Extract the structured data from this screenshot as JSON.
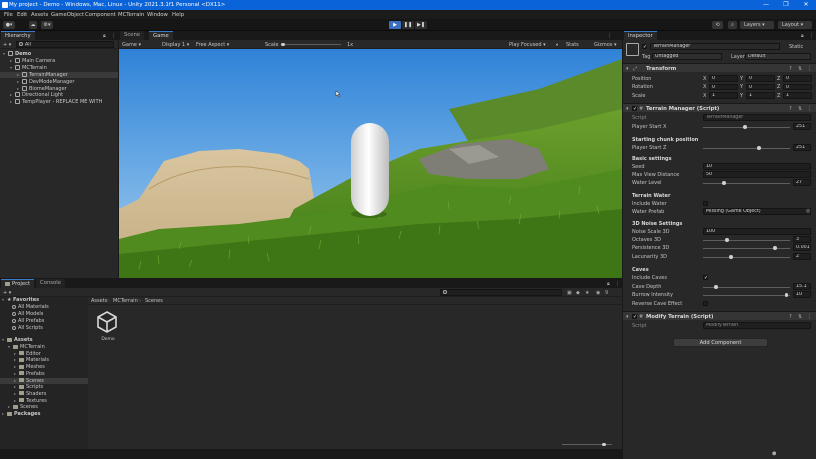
{
  "window": {
    "title": "My project - Demo - Windows, Mac, Linux - Unity 2021.3.1f1 Personal <DX11>",
    "min": "—",
    "max": "❐",
    "close": "✕"
  },
  "menu": [
    "File",
    "Edit",
    "Assets",
    "GameObject",
    "Component",
    "MCTerrain",
    "Window",
    "Help"
  ],
  "toolbar": {
    "play": "▶",
    "pause": "❚❚",
    "step": "▶❚",
    "layers": "Layers",
    "layout": "Layout"
  },
  "hierarchy": {
    "tab": "Hierarchy",
    "add": "+ ▾",
    "search_placeholder": "All",
    "items": [
      {
        "label": "Demo",
        "indent": 0
      },
      {
        "label": "Main Camera",
        "indent": 1
      },
      {
        "label": "MCTerrain",
        "indent": 1
      },
      {
        "label": "TerrainManager",
        "indent": 2,
        "selected": true
      },
      {
        "label": "DevModeManager",
        "indent": 2
      },
      {
        "label": "BiomeManager",
        "indent": 2
      },
      {
        "label": "Directional Light",
        "indent": 1
      },
      {
        "label": "TempPlayer - REPLACE ME WITH",
        "indent": 1
      }
    ]
  },
  "scene_tabs": [
    {
      "label": "Scene"
    },
    {
      "label": "Game"
    }
  ],
  "game_bar": {
    "display": "Game",
    "display_num": "Display 1",
    "aspect": "Free Aspect",
    "scale_label": "Scale",
    "scale_value": "1x",
    "play_mode": "Play Focused",
    "stats": "Stats",
    "gizmos": "Gizmos"
  },
  "bottom_tabs": [
    {
      "label": "Project"
    },
    {
      "label": "Console"
    }
  ],
  "project": {
    "badge": "9",
    "favorites": {
      "label": "Favorites",
      "items": [
        "All Materials",
        "All Models",
        "All Prefabs",
        "All Scripts"
      ]
    },
    "assets": {
      "label": "Assets",
      "tree": [
        {
          "label": "MCTerrain",
          "indent": 1
        },
        {
          "label": "Editor",
          "indent": 2
        },
        {
          "label": "Materials",
          "indent": 2
        },
        {
          "label": "Meshes",
          "indent": 2
        },
        {
          "label": "Prefabs",
          "indent": 2
        },
        {
          "label": "Scenes",
          "indent": 2,
          "selected": true
        },
        {
          "label": "Scripts",
          "indent": 2
        },
        {
          "label": "Shaders",
          "indent": 2
        },
        {
          "label": "Textures",
          "indent": 2
        },
        {
          "label": "Scenes",
          "indent": 1
        }
      ]
    },
    "packages": "Packages",
    "breadcrumb": [
      "Assets",
      "MCTerrain",
      "Scenes"
    ],
    "files": [
      {
        "name": "Demo"
      }
    ]
  },
  "inspector": {
    "tab": "Inspector",
    "object_name": "TerrainManager",
    "static": "Static",
    "tag_label": "Tag",
    "tag": "Untagged",
    "layer_label": "Layer",
    "layer": "Default",
    "transform": {
      "title": "Transform",
      "rows": [
        {
          "label": "Position",
          "x": "0",
          "y": "0",
          "z": "0"
        },
        {
          "label": "Rotation",
          "x": "0",
          "y": "0",
          "z": "0"
        },
        {
          "label": "Scale",
          "x": "1",
          "y": "1",
          "z": "1"
        }
      ]
    },
    "terrain_manager": {
      "title": "Terrain Manager (Script)",
      "script_label": "Script",
      "script": "TerrainManager",
      "player_start_x": {
        "label": "Player Start X",
        "value": "251",
        "fraction": 0.48
      },
      "starting_chunk": "Starting chunk position",
      "player_start_z": {
        "label": "Player Start Z",
        "value": "251",
        "fraction": 0.64
      },
      "basic_settings": "Basic settings",
      "seed": {
        "label": "Seed",
        "value": "10"
      },
      "max_view": {
        "label": "Max View Distance",
        "value": "50"
      },
      "water_level": {
        "label": "Water Level",
        "value": "27",
        "fraction": 0.24
      },
      "terrain_water": "Terrain Water",
      "include_water": {
        "label": "Include Water"
      },
      "water_prefab": {
        "label": "Water Prefab",
        "value": "Missing (Game Object)"
      },
      "noise3d": "3D Noise Settings",
      "noise_scale": {
        "label": "Noise Scale 3D",
        "value": "100"
      },
      "octaves": {
        "label": "Octaves 3D",
        "value": "3",
        "fraction": 0.28
      },
      "persistence": {
        "label": "Persistence 3D",
        "value": "0.001",
        "fraction": 0.83
      },
      "lacunarity": {
        "label": "Lacunarity 3D",
        "value": "2",
        "fraction": 0.32
      },
      "caves": "Caves",
      "include_caves": {
        "label": "Include Caves",
        "checked": "✓"
      },
      "cave_depth": {
        "label": "Cave Depth",
        "value": "15.1",
        "fraction": 0.15
      },
      "burrow": {
        "label": "Burrow Intensity",
        "value": "10",
        "fraction": 0.96
      },
      "reverse": {
        "label": "Reverse Cave Effect"
      }
    },
    "modify_terrain": {
      "title": "Modify Terrain (Script)",
      "script_label": "Script",
      "script": "ModifyTerrain"
    },
    "add_component": "Add Component"
  }
}
